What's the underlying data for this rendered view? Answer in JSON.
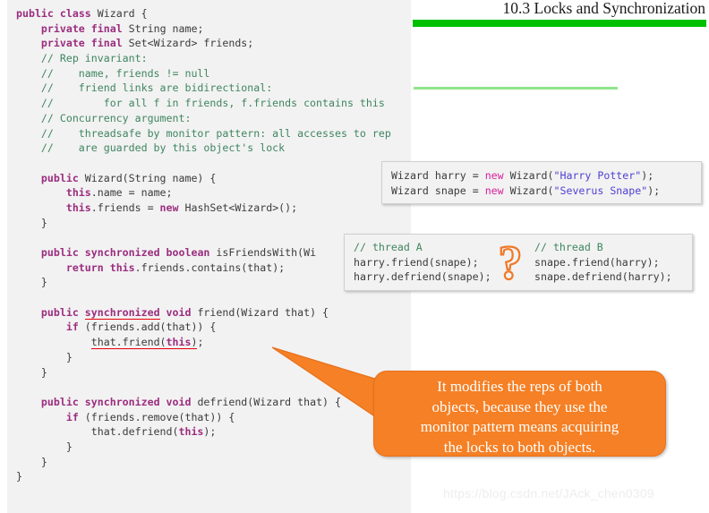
{
  "slide": {
    "title": "10.3 Locks and Synchronization",
    "title_rule_color": "#00c000",
    "accent_rule_color": "#90e58c",
    "watermark": "https://blog.csdn.net/JAck_chen0309"
  },
  "code_panel": {
    "background": "#f2f2f2",
    "lines": [
      {
        "tokens": [
          {
            "t": "public",
            "c": "kw"
          },
          {
            "t": " ",
            "c": "id"
          },
          {
            "t": "class",
            "c": "kw"
          },
          {
            "t": " Wizard {",
            "c": "id"
          }
        ]
      },
      {
        "tokens": [
          {
            "t": "    ",
            "c": "id"
          },
          {
            "t": "private",
            "c": "kw"
          },
          {
            "t": " ",
            "c": "id"
          },
          {
            "t": "final",
            "c": "kw"
          },
          {
            "t": " String name;",
            "c": "id"
          }
        ]
      },
      {
        "tokens": [
          {
            "t": "    ",
            "c": "id"
          },
          {
            "t": "private",
            "c": "kw"
          },
          {
            "t": " ",
            "c": "id"
          },
          {
            "t": "final",
            "c": "kw"
          },
          {
            "t": " Set<Wizard> friends;",
            "c": "id"
          }
        ]
      },
      {
        "tokens": [
          {
            "t": "    // Rep invariant:",
            "c": "cm"
          }
        ]
      },
      {
        "tokens": [
          {
            "t": "    //    name, friends != null",
            "c": "cm"
          }
        ]
      },
      {
        "tokens": [
          {
            "t": "    //    friend links are bidirectional:",
            "c": "cm"
          }
        ]
      },
      {
        "tokens": [
          {
            "t": "    //        for all f in friends, f.friends contains this",
            "c": "cm"
          }
        ]
      },
      {
        "tokens": [
          {
            "t": "    // Concurrency argument:",
            "c": "cm"
          }
        ]
      },
      {
        "tokens": [
          {
            "t": "    //    threadsafe by monitor pattern: all accesses to rep",
            "c": "cm"
          }
        ]
      },
      {
        "tokens": [
          {
            "t": "    //    are guarded by this object's lock",
            "c": "cm"
          }
        ]
      },
      {
        "tokens": []
      },
      {
        "tokens": [
          {
            "t": "    ",
            "c": "id"
          },
          {
            "t": "public",
            "c": "kw"
          },
          {
            "t": " Wizard(String name) {",
            "c": "id"
          }
        ]
      },
      {
        "tokens": [
          {
            "t": "        ",
            "c": "id"
          },
          {
            "t": "this",
            "c": "kw"
          },
          {
            "t": ".name = name;",
            "c": "id"
          }
        ]
      },
      {
        "tokens": [
          {
            "t": "        ",
            "c": "id"
          },
          {
            "t": "this",
            "c": "kw"
          },
          {
            "t": ".friends = ",
            "c": "id"
          },
          {
            "t": "new",
            "c": "kw"
          },
          {
            "t": " HashSet<Wizard>();",
            "c": "id"
          }
        ]
      },
      {
        "tokens": [
          {
            "t": "    }",
            "c": "id"
          }
        ]
      },
      {
        "tokens": []
      },
      {
        "tokens": [
          {
            "t": "    ",
            "c": "id"
          },
          {
            "t": "public",
            "c": "kw"
          },
          {
            "t": " ",
            "c": "id"
          },
          {
            "t": "synchronized",
            "c": "kw"
          },
          {
            "t": " ",
            "c": "id"
          },
          {
            "t": "boolean",
            "c": "kw"
          },
          {
            "t": " isFriendsWith(Wi",
            "c": "id"
          }
        ]
      },
      {
        "tokens": [
          {
            "t": "        ",
            "c": "id"
          },
          {
            "t": "return",
            "c": "kw"
          },
          {
            "t": " ",
            "c": "id"
          },
          {
            "t": "this",
            "c": "kw"
          },
          {
            "t": ".friends.contains(that);",
            "c": "id"
          }
        ]
      },
      {
        "tokens": [
          {
            "t": "    }",
            "c": "id"
          }
        ]
      },
      {
        "tokens": []
      },
      {
        "tokens": [
          {
            "t": "    ",
            "c": "id"
          },
          {
            "t": "public",
            "c": "kw"
          },
          {
            "t": " ",
            "c": "id"
          },
          {
            "t": "synchronized",
            "c": "kw uline-red"
          },
          {
            "t": " ",
            "c": "id"
          },
          {
            "t": "void",
            "c": "kw"
          },
          {
            "t": " friend(Wizard that) {",
            "c": "id"
          }
        ]
      },
      {
        "tokens": [
          {
            "t": "        ",
            "c": "id"
          },
          {
            "t": "if",
            "c": "kw"
          },
          {
            "t": " (friends.add(that)) {",
            "c": "id"
          }
        ]
      },
      {
        "tokens": [
          {
            "t": "            ",
            "c": "id"
          },
          {
            "t": "that.friend(",
            "c": "id uline-red"
          },
          {
            "t": "this",
            "c": "kw uline-red"
          },
          {
            "t": ")",
            "c": "id uline-red"
          },
          {
            "t": ";",
            "c": "id"
          }
        ]
      },
      {
        "tokens": [
          {
            "t": "        }",
            "c": "id"
          }
        ]
      },
      {
        "tokens": [
          {
            "t": "    }",
            "c": "id"
          }
        ]
      },
      {
        "tokens": []
      },
      {
        "tokens": [
          {
            "t": "    ",
            "c": "id"
          },
          {
            "t": "public",
            "c": "kw"
          },
          {
            "t": " ",
            "c": "id"
          },
          {
            "t": "synchronized",
            "c": "kw"
          },
          {
            "t": " ",
            "c": "id"
          },
          {
            "t": "void",
            "c": "kw"
          },
          {
            "t": " defriend(Wizard that) {",
            "c": "id"
          }
        ]
      },
      {
        "tokens": [
          {
            "t": "        ",
            "c": "id"
          },
          {
            "t": "if",
            "c": "kw"
          },
          {
            "t": " (friends.remove(that)) {",
            "c": "id"
          }
        ]
      },
      {
        "tokens": [
          {
            "t": "            that.defriend(",
            "c": "id"
          },
          {
            "t": "this",
            "c": "kw"
          },
          {
            "t": ");",
            "c": "id"
          }
        ]
      },
      {
        "tokens": [
          {
            "t": "        }",
            "c": "id"
          }
        ]
      },
      {
        "tokens": [
          {
            "t": "    }",
            "c": "id"
          }
        ]
      },
      {
        "tokens": [
          {
            "t": "}",
            "c": "id"
          }
        ]
      }
    ]
  },
  "construct_box": {
    "lines": [
      {
        "tokens": [
          {
            "t": "Wizard harry = ",
            "c": "id"
          },
          {
            "t": "new",
            "c": "newkw"
          },
          {
            "t": " Wizard(",
            "c": "id"
          },
          {
            "t": "\"Harry Potter\"",
            "c": "str"
          },
          {
            "t": ");",
            "c": "id"
          }
        ]
      },
      {
        "tokens": [
          {
            "t": "Wizard snape = ",
            "c": "id"
          },
          {
            "t": "new",
            "c": "newkw"
          },
          {
            "t": " Wizard(",
            "c": "id"
          },
          {
            "t": "\"Severus Snape\"",
            "c": "str"
          },
          {
            "t": ");",
            "c": "id"
          }
        ]
      }
    ]
  },
  "threads_box": {
    "thread_a": {
      "lines": [
        {
          "tokens": [
            {
              "t": "// thread A",
              "c": "cm"
            }
          ]
        },
        {
          "tokens": [
            {
              "t": "harry.friend(snape);",
              "c": "id"
            }
          ]
        },
        {
          "tokens": [
            {
              "t": "harry.defriend(snape);",
              "c": "id"
            }
          ]
        }
      ]
    },
    "thread_b": {
      "lines": [
        {
          "tokens": [
            {
              "t": "// thread B",
              "c": "cm"
            }
          ]
        },
        {
          "tokens": [
            {
              "t": "snape.friend(harry);",
              "c": "id"
            }
          ]
        },
        {
          "tokens": [
            {
              "t": "snape.defriend(harry);",
              "c": "id"
            }
          ]
        }
      ]
    },
    "question_glyph": "?"
  },
  "callout": {
    "color": "#f58025",
    "text_lines": [
      "It modifies the reps of both",
      "objects, because they use the",
      "monitor pattern means acquiring",
      "the locks to both objects."
    ]
  }
}
